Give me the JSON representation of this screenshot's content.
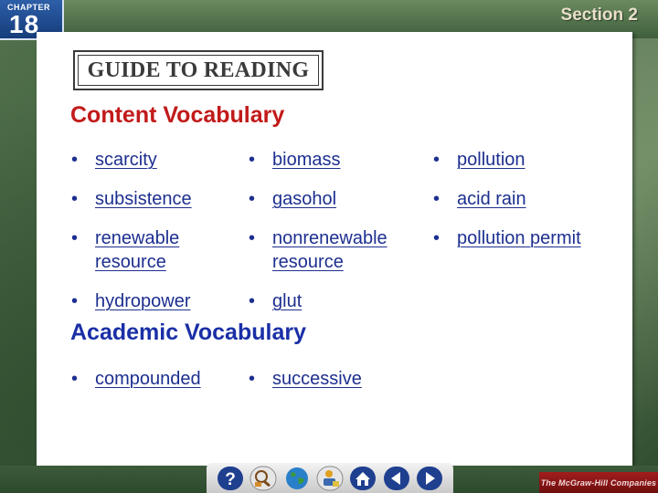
{
  "header": {
    "chapter_label": "CHAPTER",
    "chapter_number": "18",
    "section_label": "Section 2"
  },
  "guide": {
    "title": "GUIDE TO READING"
  },
  "content_vocabulary": {
    "heading": "Content Vocabulary",
    "terms": [
      "scarcity",
      "biomass",
      "pollution",
      "subsistence",
      "gasohol",
      "acid rain",
      "renewable\nresource",
      "nonrenewable\nresource",
      "pollution permit",
      "hydropower",
      "glut"
    ]
  },
  "academic_vocabulary": {
    "heading": "Academic Vocabulary",
    "terms": [
      "compounded",
      "successive"
    ]
  },
  "bullet": "•",
  "nav": {
    "buttons": [
      "help-icon",
      "resources-icon",
      "globe-icon",
      "skills-icon",
      "home-icon",
      "previous-icon",
      "next-icon"
    ],
    "help_glyph": "?"
  },
  "publisher": {
    "text": "The McGraw-Hill Companies"
  },
  "colors": {
    "content_heading": "#c21a1a",
    "academic_heading": "#1a2fa6",
    "term_text": "#1d2f8f",
    "chapter_badge": "#1f4a90",
    "nav_button": "#1f3f8f"
  }
}
